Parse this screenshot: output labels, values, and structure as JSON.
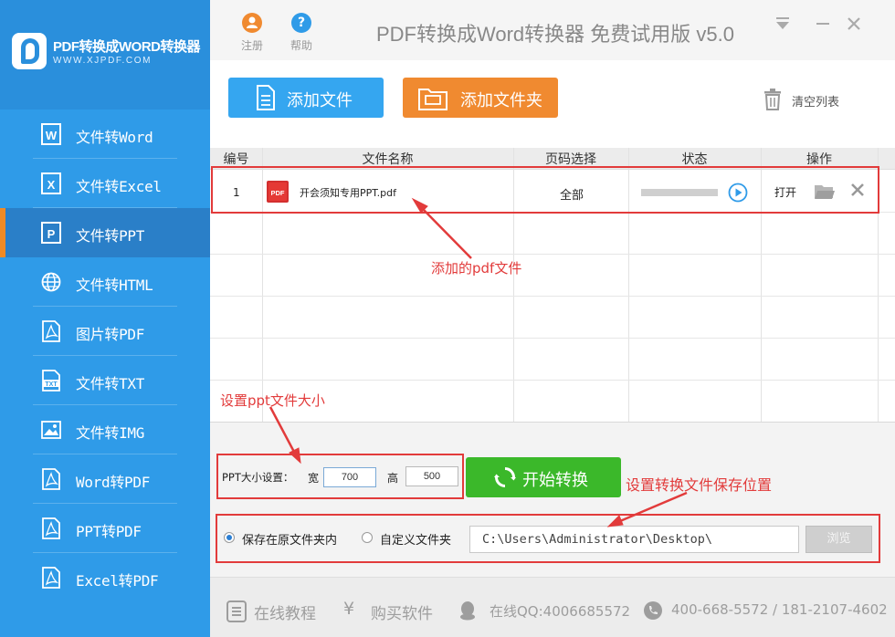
{
  "app": {
    "logo_title": "PDF转换成WORD转换器",
    "logo_subtitle": "WWW.XJPDF.COM",
    "window_title": "PDF转换成Word转换器 免费试用版 v5.0",
    "register_label": "注册",
    "help_label": "帮助"
  },
  "sidebar": {
    "items": [
      {
        "label": "文件转Word",
        "icon": "word-icon"
      },
      {
        "label": "文件转Excel",
        "icon": "excel-icon"
      },
      {
        "label": "文件转PPT",
        "icon": "ppt-icon",
        "active": true
      },
      {
        "label": "文件转HTML",
        "icon": "globe-icon"
      },
      {
        "label": "图片转PDF",
        "icon": "pdf-icon"
      },
      {
        "label": "文件转TXT",
        "icon": "txt-icon"
      },
      {
        "label": "文件转IMG",
        "icon": "image-icon"
      },
      {
        "label": "Word转PDF",
        "icon": "pdf-icon"
      },
      {
        "label": "PPT转PDF",
        "icon": "pdf-icon"
      },
      {
        "label": "Excel转PDF",
        "icon": "pdf-icon"
      }
    ]
  },
  "toolbar": {
    "add_file_label": "添加文件",
    "add_folder_label": "添加文件夹",
    "clear_list_label": "清空列表"
  },
  "table": {
    "columns": [
      "编号",
      "文件名称",
      "页码选择",
      "状态",
      "操作"
    ],
    "rows": [
      {
        "index": "1",
        "file_name": "开会须知专用PPT.pdf",
        "pages": "全部",
        "progress": 0,
        "open_label": "打开"
      }
    ]
  },
  "settings": {
    "ppt_size_label": "PPT大小设置：",
    "width_label": "宽",
    "width_value": "700",
    "height_label": "高",
    "height_value": "500",
    "start_label": "开始转换",
    "save_original_label": "保存在原文件夹内",
    "custom_folder_label": "自定义文件夹",
    "save_mode": "original",
    "path_value": "C:\\Users\\Administrator\\Desktop\\",
    "browse_label": "浏览"
  },
  "footer": {
    "tutorial_label": "在线教程",
    "buy_label": "购买软件",
    "qq_label": "在线QQ:4006685572",
    "phone_label": "400-668-5572 / 181-2107-4602"
  },
  "annotations": {
    "added_pdf": "添加的pdf文件",
    "ppt_size": "设置ppt文件大小",
    "save_location": "设置转换文件保存位置"
  },
  "colors": {
    "sidebar_bg": "#2f9be8",
    "active_bg": "#2a7fc8",
    "active_marker": "#f08a24",
    "add_file_btn": "#35a6f0",
    "add_folder_btn": "#f08a30",
    "start_btn": "#3bb82a",
    "annotation": "#e23b3b"
  }
}
